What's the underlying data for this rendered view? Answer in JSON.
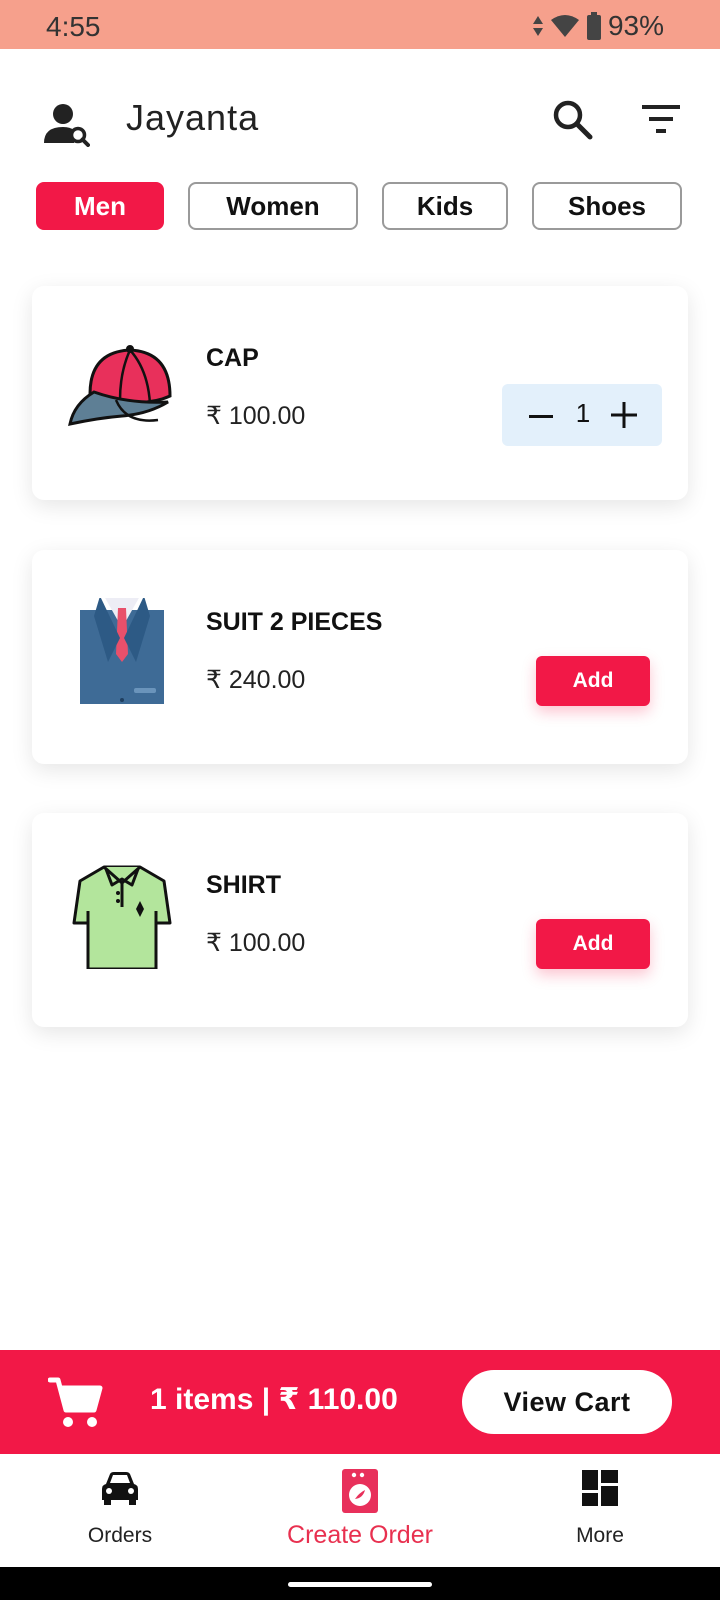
{
  "status_bar": {
    "time": "4:55",
    "battery": "93%"
  },
  "header": {
    "title": "Jayanta"
  },
  "tabs": [
    {
      "label": "Men",
      "active": true
    },
    {
      "label": "Women",
      "active": false
    },
    {
      "label": "Kids",
      "active": false
    },
    {
      "label": "Shoes",
      "active": false
    }
  ],
  "products": [
    {
      "name": "CAP",
      "price": "₹ 100.00",
      "quantity": "1",
      "in_cart": true,
      "icon": "cap-icon"
    },
    {
      "name": "SUIT 2 PIECES",
      "price": "₹ 240.00",
      "add_label": "Add",
      "in_cart": false,
      "icon": "suit-icon"
    },
    {
      "name": "SHIRT",
      "price": "₹ 100.00",
      "add_label": "Add",
      "in_cart": false,
      "icon": "shirt-icon"
    }
  ],
  "cart_bar": {
    "summary": "1 items | ₹ 110.00",
    "button_label": "View Cart"
  },
  "bottom_nav": [
    {
      "label": "Orders",
      "icon": "car-icon",
      "active": false
    },
    {
      "label": "Create Order",
      "icon": "washing-machine-icon",
      "active": true
    },
    {
      "label": "More",
      "icon": "dashboard-icon",
      "active": false
    }
  ],
  "colors": {
    "accent": "#F21847",
    "status_bar": "#F6A08C",
    "stepper_bg": "#E3F0FB"
  }
}
